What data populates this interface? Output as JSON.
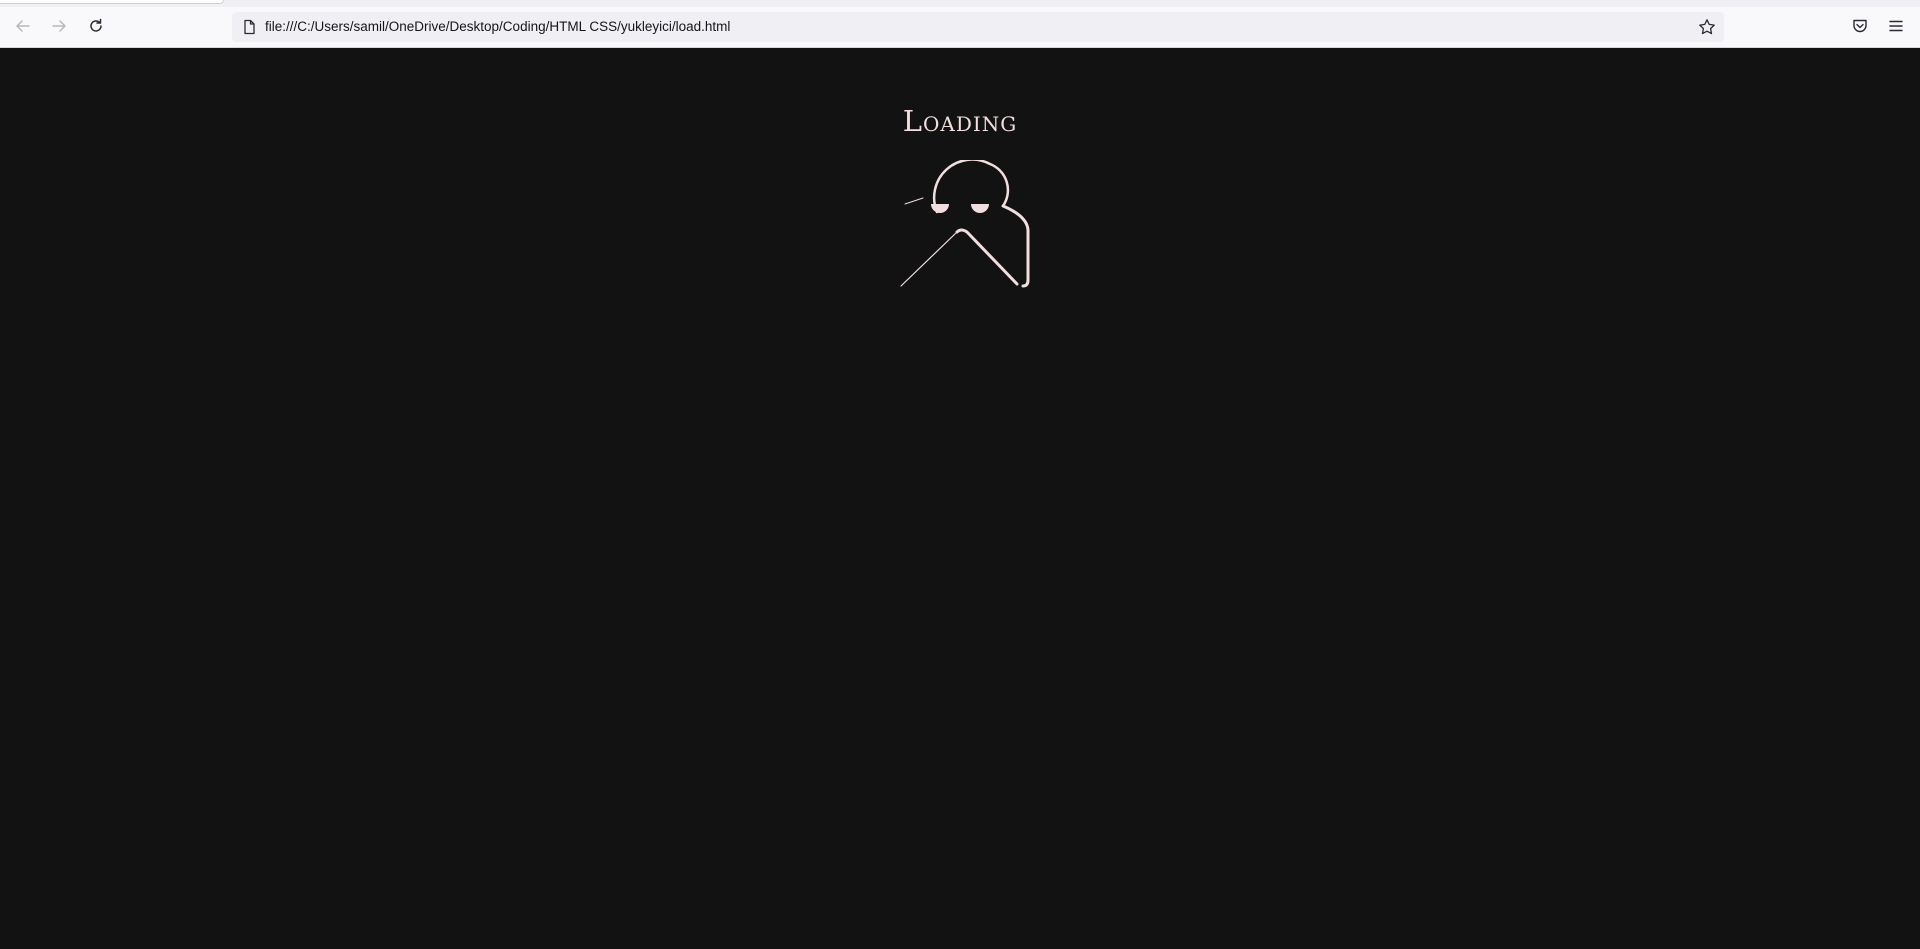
{
  "browser": {
    "url": "file:///C:/Users/samil/OneDrive/Desktop/Coding/HTML CSS/yukleyici/load.html",
    "icons": {
      "back": "arrow-left-icon",
      "forward": "arrow-right-icon",
      "reload": "reload-icon",
      "page": "page-icon",
      "bookmark": "star-icon",
      "pocket": "pocket-icon",
      "menu": "hamburger-menu-icon"
    }
  },
  "page": {
    "title": "Loading",
    "background": "#121212",
    "accent": "#f2dede"
  }
}
